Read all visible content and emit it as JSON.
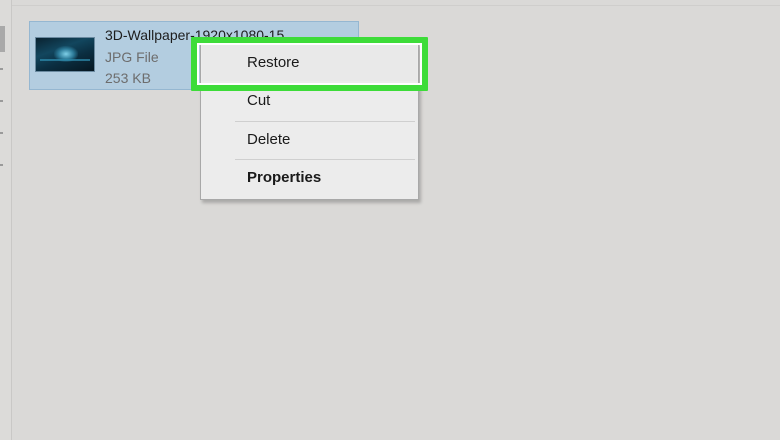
{
  "file": {
    "name": "3D-Wallpaper-1920x1080-15",
    "type": "JPG File",
    "size": "253 KB",
    "thumbnail": "wallpaper-thumbnail"
  },
  "context_menu": {
    "items": [
      {
        "label": "Restore",
        "highlighted": true,
        "bold": false
      },
      {
        "label": "Cut",
        "highlighted": false,
        "bold": false
      },
      {
        "label": "Delete",
        "highlighted": false,
        "bold": false
      },
      {
        "label": "Properties",
        "highlighted": false,
        "bold": true
      }
    ]
  },
  "colors": {
    "background": "#dad9d7",
    "selection": "#b3cde0",
    "menu_background": "#ececec",
    "highlight": "#3ddc39"
  }
}
